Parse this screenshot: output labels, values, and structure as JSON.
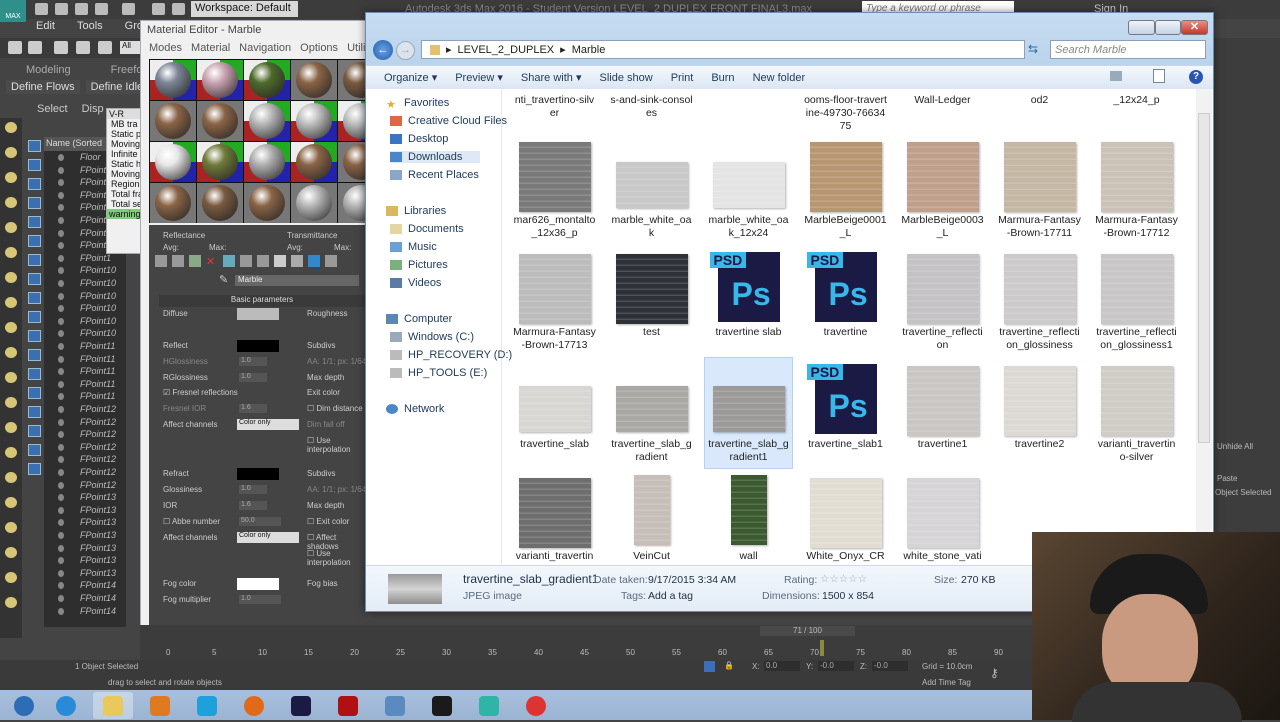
{
  "max": {
    "logo": "MAX",
    "workspace": "Workspace: Default",
    "title": "Autodesk 3ds Max 2016 - Student Version    LEVEL_2 DUPLEX FRONT FINAL3.max",
    "help_search_placeholder": "Type a keyword or phrase",
    "sign_in": "Sign In",
    "menu": [
      "Edit",
      "Tools",
      "Group"
    ],
    "selection_filter": "All",
    "ribbon_tabs": [
      "Modeling",
      "Freeform"
    ],
    "ribbon_buttons": [
      "Define Flows",
      "Define Idle Ar"
    ],
    "command_tabs": [
      "Select",
      "Disp"
    ],
    "scene_explorer": {
      "header": "Name (Sorted",
      "rows": [
        "Floor",
        "FPoint1",
        "FPoint1",
        "FPoint1",
        "FPoint1",
        "FPoint1",
        "FPoint1",
        "FPoint1",
        "FPoint1",
        "FPoint10",
        "FPoint10",
        "FPoint10",
        "FPoint10",
        "FPoint10",
        "FPoint10",
        "FPoint11",
        "FPoint11",
        "FPoint11",
        "FPoint11",
        "FPoint11",
        "FPoint12",
        "FPoint12",
        "FPoint12",
        "FPoint12",
        "FPoint12",
        "FPoint12",
        "FPoint12",
        "FPoint13",
        "FPoint13",
        "FPoint13",
        "FPoint13",
        "FPoint13",
        "FPoint13",
        "FPoint13",
        "FPoint14",
        "FPoint14",
        "FPoint14"
      ]
    },
    "vray_log": {
      "title": "V-R",
      "lines": [
        "MB tra",
        "Static p",
        "Moving",
        "Infinite",
        "Static h",
        "Moving",
        "Region",
        "Total fra",
        "Total se"
      ],
      "warning": "warning"
    },
    "timeline": {
      "frame_display": "71 / 100",
      "current_frame": 71,
      "ticks": [
        "0",
        "5",
        "10",
        "15",
        "20",
        "25",
        "30",
        "35",
        "40",
        "45",
        "50",
        "55",
        "60",
        "65",
        "70",
        "75",
        "80",
        "85",
        "90"
      ]
    },
    "status": {
      "selection": "1 Object Selected",
      "prompt": "drag to select and rotate objects",
      "x": "0.0",
      "y": "-0.0",
      "z": "-0.0",
      "x_label": "X:",
      "y_label": "Y:",
      "z_label": "Z:",
      "grid": "Grid = 10.0cm",
      "add_time_tag": "Add Time Tag"
    },
    "right_panel": [
      "Unhide All",
      "Paste",
      "Object Selected"
    ]
  },
  "material_editor": {
    "title": "Material Editor - Marble",
    "menu": [
      "Modes",
      "Material",
      "Navigation",
      "Options",
      "Utilities"
    ],
    "slots": [
      "#7d8696",
      "#c9a4b0",
      "#4e6a2a",
      "#8a6446",
      "#7a5a40",
      "#8a6446",
      "#8a6446",
      "#b8b8b8",
      "#c0c0c0",
      "#c0c0c0",
      "#e8e8e8",
      "#6f7a3a",
      "#b0b0b0",
      "#8a6446",
      "#8a6446",
      "#8a6446",
      "#7a5a40",
      "#8a6446",
      "#b8b8b8",
      "#b8b8b8"
    ],
    "checker_slots": [
      0,
      1,
      2,
      7,
      8,
      9,
      10,
      11,
      12,
      13
    ],
    "reflectance": "Reflectance",
    "transmittance": "Transmittance",
    "avg": "Avg:",
    "max": "Max:",
    "material_name": "Marble",
    "rollout": "Basic parameters",
    "diffuse": "Diffuse",
    "roughness": "Roughness",
    "reflect": "Reflect",
    "subdivs": "Subdivs",
    "hglossiness": "HGlossiness",
    "hglossiness_value": "1.0",
    "aa": "AA: 1/1; px: 1/64",
    "rglossiness": "RGlossiness",
    "rglossiness_value": "1.0",
    "max_depth": "Max depth",
    "fresnel": "Fresnel reflections",
    "exit_color": "Exit color",
    "fresnel_ior": "Fresnel IOR",
    "fresnel_ior_value": "1.6",
    "dim_distance": "Dim distance",
    "affect_channels": "Affect channels",
    "color_only": "Color only",
    "dim_falloff": "Dim fall off",
    "use_interpolation": "Use interpolation",
    "refract": "Refract",
    "glossiness": "Glossiness",
    "glossiness_value": "1.0",
    "ior": "IOR",
    "ior_value": "1.6",
    "abbe": "Abbe number",
    "abbe_value": "50.0",
    "affect_shadows": "Affect shadows",
    "fog_color": "Fog color",
    "fog_bias": "Fog bias",
    "fog_multiplier": "Fog multiplier",
    "fog_multiplier_value": "1.0"
  },
  "explorer": {
    "breadcrumb": [
      "LEVEL_2_DUPLEX",
      "Marble"
    ],
    "search_placeholder": "Search Marble",
    "toolbar": [
      "Organize ▾",
      "Preview ▾",
      "Share with ▾",
      "Slide show",
      "Print",
      "Burn",
      "New folder"
    ],
    "nav": {
      "favorites": "Favorites",
      "favorites_items": [
        "Creative Cloud Files",
        "Desktop",
        "Downloads",
        "Recent Places"
      ],
      "libraries": "Libraries",
      "libraries_items": [
        "Documents",
        "Music",
        "Pictures",
        "Videos"
      ],
      "computer": "Computer",
      "computer_items": [
        "Windows (C:)",
        "HP_RECOVERY (D:)",
        "HP_TOOLS (E:)"
      ],
      "network": "Network"
    },
    "files": [
      {
        "name": "nti_travertino-silver",
        "kind": "none"
      },
      {
        "name": "s-and-sink-consoles",
        "kind": "none"
      },
      {
        "name": "",
        "kind": "none"
      },
      {
        "name": "ooms-floor-travertine-49730-7663475",
        "kind": "none"
      },
      {
        "name": "Wall-Ledger",
        "kind": "none"
      },
      {
        "name": "od2",
        "kind": "none"
      },
      {
        "name": "_12x24_p",
        "kind": "none"
      },
      {
        "name": "mar626_montalto_12x36_p",
        "kind": "square",
        "color": "#7a7a7a"
      },
      {
        "name": "marble_white_oak",
        "kind": "land",
        "color": "#c8c8c8"
      },
      {
        "name": "marble_white_oak_12x24",
        "kind": "land",
        "color": "#e4e4e4"
      },
      {
        "name": "MarbleBeige0001_L",
        "kind": "square",
        "color": "#b89672"
      },
      {
        "name": "MarbleBeige0003_L",
        "kind": "square",
        "color": "#c0a08c"
      },
      {
        "name": "Marmura-Fantasy-Brown-17711",
        "kind": "square",
        "color": "#c4b8a4"
      },
      {
        "name": "Marmura-Fantasy-Brown-17712",
        "kind": "square",
        "color": "#cac2b6"
      },
      {
        "name": "Marmura-Fantasy-Brown-17713",
        "kind": "square",
        "color": "#bcbcbc"
      },
      {
        "name": "test",
        "kind": "square",
        "color": "#2e3138"
      },
      {
        "name": "travertine slab",
        "kind": "psd"
      },
      {
        "name": "travertine",
        "kind": "psd"
      },
      {
        "name": "travertine_reflection",
        "kind": "square",
        "color": "#c4c2c4"
      },
      {
        "name": "travertine_reflection_glossiness",
        "kind": "square",
        "color": "#cccaca"
      },
      {
        "name": "travertine_reflection_glossiness1",
        "kind": "square",
        "color": "#c8c6c6"
      },
      {
        "name": "travertine_slab",
        "kind": "land",
        "color": "#d8d6d2"
      },
      {
        "name": "travertine_slab_gradient",
        "kind": "land",
        "color": "#aaa8a4"
      },
      {
        "name": "travertine_slab_gradient1",
        "kind": "land",
        "color": "#9c9a98",
        "selected": true
      },
      {
        "name": "travertine_slab1",
        "kind": "psd"
      },
      {
        "name": "travertine1",
        "kind": "square",
        "color": "#cac6c4"
      },
      {
        "name": "travertine2",
        "kind": "square",
        "color": "#dcd8d4"
      },
      {
        "name": "varianti_travertino-silver",
        "kind": "square",
        "color": "#cfcdc6"
      },
      {
        "name": "varianti_travertino",
        "kind": "square",
        "color": "#6e6e6e"
      },
      {
        "name": "VeinCut",
        "kind": "portrait",
        "color": "#c6beb8"
      },
      {
        "name": "wall",
        "kind": "portrait",
        "color": "#3b5a30"
      },
      {
        "name": "White_Onyx_CRO",
        "kind": "square",
        "color": "#e2ddd2"
      },
      {
        "name": "white_stone_vatic",
        "kind": "square",
        "color": "#d6d4d6"
      }
    ],
    "details": {
      "name": "travertine_slab_gradient1",
      "type": "JPEG image",
      "date_label": "Date taken:",
      "date": "9/17/2015 3:34 AM",
      "tags_label": "Tags:",
      "tags": "Add a tag",
      "rating_label": "Rating:",
      "rating": 0,
      "rating_stars": "☆☆☆☆☆",
      "dimensions_label": "Dimensions:",
      "dimensions": "1500 x 854",
      "size_label": "Size:",
      "size": "270 KB"
    }
  },
  "taskbar": [
    "start",
    "internet-explorer",
    "file-explorer",
    "media-player",
    "skype",
    "firefox",
    "photoshop",
    "acrobat",
    "photo-viewer",
    "camtasia",
    "3ds-max",
    "chrome"
  ],
  "taskbar_colors": [
    "#2d6db5",
    "#2a8ad8",
    "#e8c95a",
    "#e07a20",
    "#1ea0dc",
    "#e06a1a",
    "#1b1a45",
    "#b01010",
    "#5a8ac0",
    "#1a1a1a",
    "#2fb5a8",
    "#d33"
  ]
}
